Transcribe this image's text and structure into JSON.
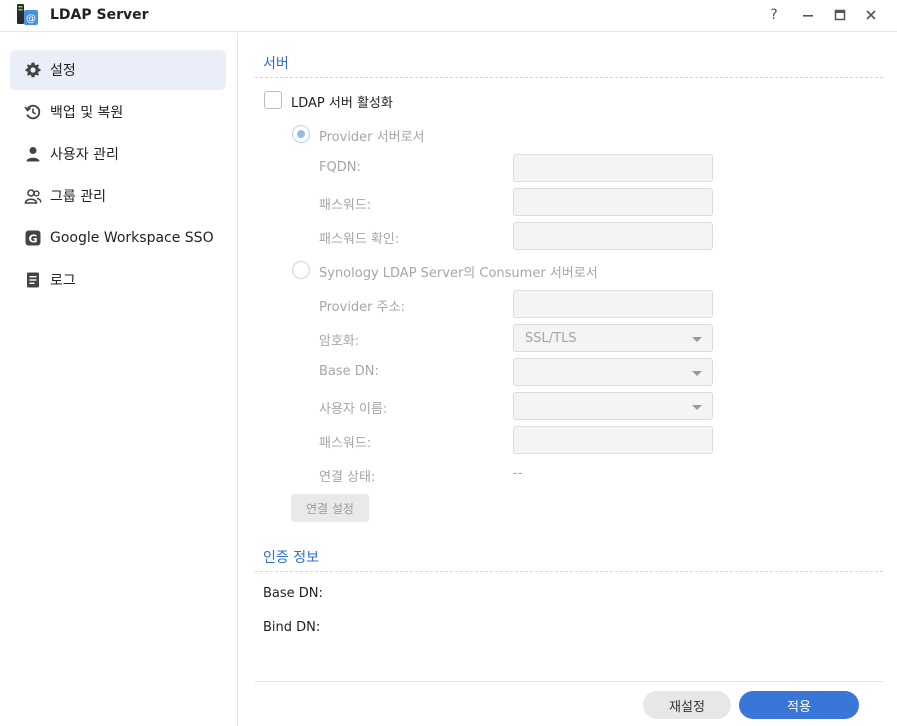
{
  "window": {
    "title": "LDAP Server",
    "help": "?",
    "minimize": "–",
    "maximize": "☐",
    "close": "✕"
  },
  "sidebar": {
    "items": [
      {
        "label": "설정",
        "icon": "gear-icon",
        "active": true
      },
      {
        "label": "백업 및 복원",
        "icon": "history-icon"
      },
      {
        "label": "사용자 관리",
        "icon": "user-icon"
      },
      {
        "label": "그룹 관리",
        "icon": "group-icon"
      },
      {
        "label": "Google Workspace SSO",
        "icon": "google-g-icon"
      },
      {
        "label": "로그",
        "icon": "log-icon"
      }
    ]
  },
  "server": {
    "title": "서버",
    "enable_label": "LDAP 서버 활성화",
    "provider_label": "Provider 서버로서",
    "fqdn_label": "FQDN:",
    "password_label": "패스워드:",
    "confirm_password_label": "패스워드 확인:",
    "consumer_label": "Synology LDAP Server의 Consumer 서버로서",
    "provider_address_label": "Provider 주소:",
    "encryption_label": "암호화:",
    "encryption_value": "SSL/TLS",
    "base_dn_label": "Base DN:",
    "username_label": "사용자 이름:",
    "consumer_password_label": "패스워드:",
    "connection_status_label": "연결 상태:",
    "connection_status_value": "--",
    "connect_button": "연결 설정"
  },
  "auth": {
    "title": "인증 정보",
    "base_dn_label": "Base DN:",
    "bind_dn_label": "Bind DN:"
  },
  "footer": {
    "reset": "재설정",
    "apply": "적용"
  },
  "colors": {
    "accent": "#3a76d8",
    "section_title": "#2f6fd0",
    "active_nav": "#e9eef8"
  }
}
